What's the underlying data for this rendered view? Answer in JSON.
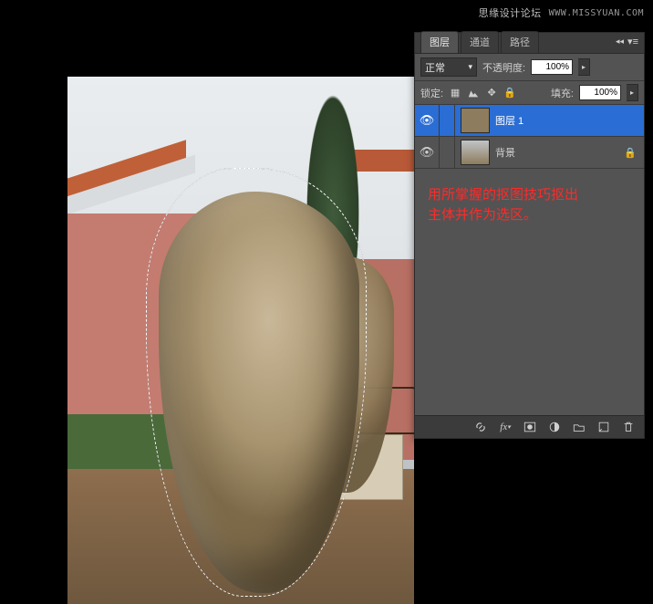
{
  "watermark": {
    "text": "思缘设计论坛",
    "url": "WWW.MISSYUAN.COM"
  },
  "panel": {
    "tabs": {
      "layers": "图层",
      "channels": "通道",
      "paths": "路径"
    },
    "blend_mode_label": "正常",
    "opacity_label": "不透明度:",
    "opacity_value": "100%",
    "lock_label": "锁定:",
    "fill_label": "填充:",
    "fill_value": "100%",
    "layers": [
      {
        "name": "图层 1",
        "visible": true,
        "selected": true,
        "locked": false
      },
      {
        "name": "背景",
        "visible": true,
        "selected": false,
        "locked": true
      }
    ]
  },
  "instruction_line1": "用所掌握的抠图技巧抠出",
  "instruction_line2": "主体并作为选区。",
  "icons": {
    "link": "link-icon",
    "fx": "fx-icon",
    "mask": "mask-icon",
    "adjust": "adjustment-icon",
    "group": "group-icon",
    "new": "new-layer-icon",
    "trash": "trash-icon"
  }
}
